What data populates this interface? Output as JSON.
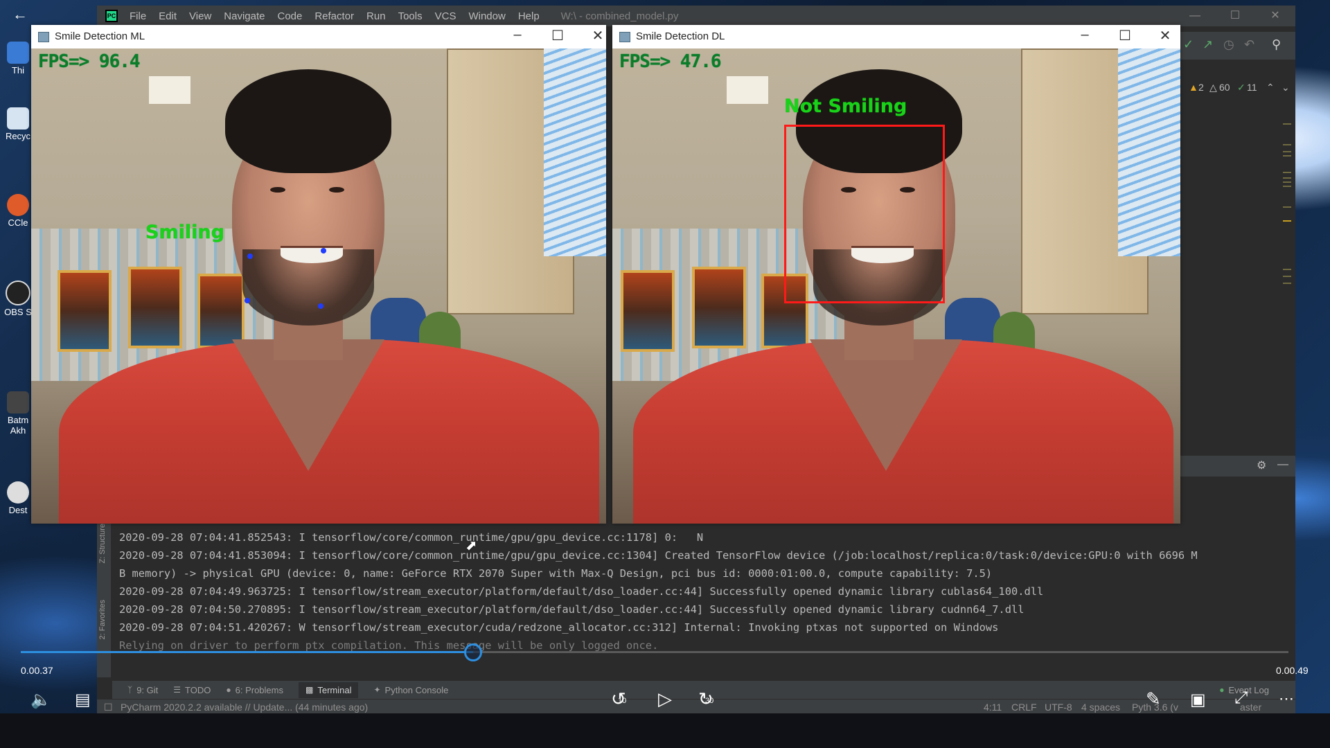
{
  "desktop": {
    "icons": [
      "Thi",
      "Recyc",
      "CCle",
      "OBS S",
      "Batm\nAkh",
      "Dest"
    ]
  },
  "ide": {
    "menu": [
      "File",
      "Edit",
      "View",
      "Navigate",
      "Code",
      "Refactor",
      "Run",
      "Tools",
      "VCS",
      "Window",
      "Help"
    ],
    "path": "W:\\ - combined_model.py",
    "inspections": {
      "warnings": "2",
      "weak_warnings": "60",
      "typos": "11"
    },
    "side_labels": {
      "structure": "Z: Structure",
      "favorites": "2: Favorites"
    },
    "console_lines": [
      "2020-09-28 07:04:41.852543: I tensorflow/core/common_runtime/gpu/gpu_device.cc:1178] 0:   N",
      "2020-09-28 07:04:41.853094: I tensorflow/core/common_runtime/gpu/gpu_device.cc:1304] Created TensorFlow device (/job:localhost/replica:0/task:0/device:GPU:0 with 6696 M",
      "B memory) -> physical GPU (device: 0, name: GeForce RTX 2070 Super with Max-Q Design, pci bus id: 0000:01:00.0, compute capability: 7.5)",
      "2020-09-28 07:04:49.963725: I tensorflow/stream_executor/platform/default/dso_loader.cc:44] Successfully opened dynamic library cublas64_100.dll",
      "2020-09-28 07:04:50.270895: I tensorflow/stream_executor/platform/default/dso_loader.cc:44] Successfully opened dynamic library cudnn64_7.dll",
      "2020-09-28 07:04:51.420267: W tensorflow/stream_executor/cuda/redzone_allocator.cc:312] Internal: Invoking ptxas not supported on Windows",
      "Relying on driver to perform ptx compilation. This message will be only logged once."
    ],
    "tool_tabs": [
      "9: Git",
      "TODO",
      "6: Problems",
      "Terminal",
      "Python Console"
    ],
    "active_tab": "Terminal",
    "event_log": "Event Log",
    "status": {
      "message": "PyCharm 2020.2.2 available // Update... (44 minutes ago)",
      "position": "4:11",
      "line_sep": "CRLF",
      "encoding": "UTF-8",
      "indent": "4 spaces",
      "interpreter": "Pyth 3.6 (v",
      "branch": "aster"
    }
  },
  "windows": {
    "ml": {
      "title": "Smile Detection ML",
      "fps": "FPS=> 96.4",
      "label": "Smiling"
    },
    "dl": {
      "title": "Smile Detection DL",
      "fps": "FPS=> 47.6",
      "label": "Not Smiling"
    },
    "accent_colors": {
      "label": "#19d219",
      "fps": "#0b7d2a",
      "bbox": "#ff1a1a",
      "landmark": "#1f3cff"
    }
  },
  "player": {
    "current_time": "0.00.37",
    "total_time": "0.00.49",
    "progress": 0.357,
    "skip_back": "10",
    "skip_forward": "30",
    "accent": "#2d8fe0"
  }
}
